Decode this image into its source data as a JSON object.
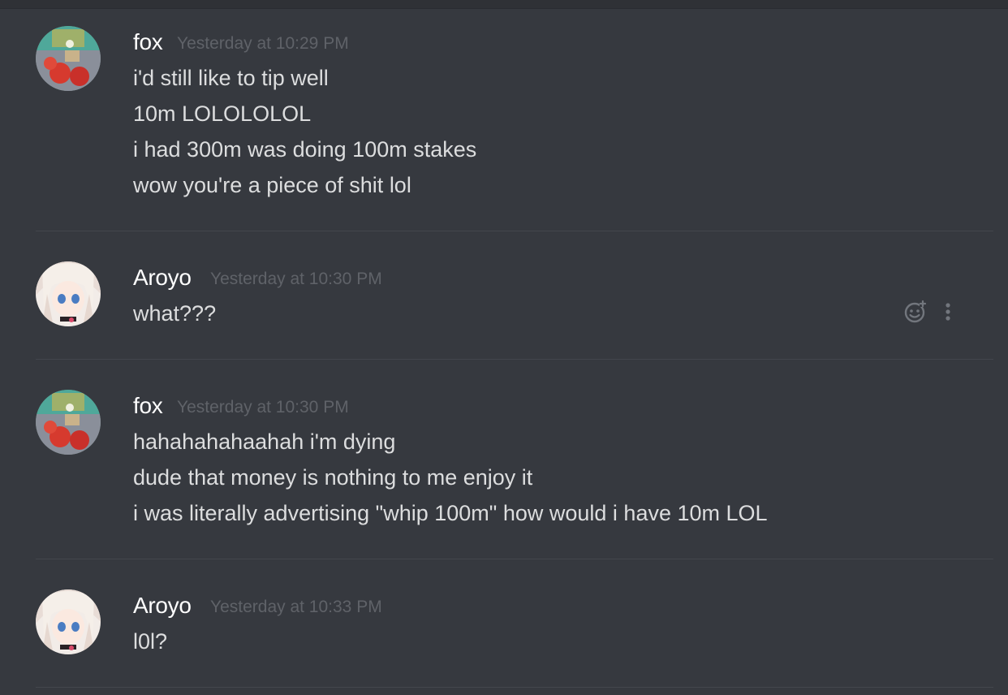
{
  "messages": [
    {
      "author": "fox",
      "timestamp": "Yesterday at 10:29 PM",
      "avatar": "fox-avatar",
      "lines": [
        "i'd still like to tip well",
        "10m LOLOLOLOL",
        "i had 300m was doing 100m stakes",
        "wow you're a piece of shit lol"
      ]
    },
    {
      "author": "Aroyo",
      "timestamp": "Yesterday at 10:30 PM",
      "avatar": "aroyo-avatar",
      "lines": [
        "what???"
      ]
    },
    {
      "author": "fox",
      "timestamp": "Yesterday at 10:30 PM",
      "avatar": "fox-avatar",
      "lines": [
        "hahahahahaahah i'm dying",
        "dude that money is nothing to me enjoy it",
        "i was literally advertising \"whip 100m\" how would i have 10m LOL"
      ]
    },
    {
      "author": "Aroyo",
      "timestamp": "Yesterday at 10:33 PM",
      "avatar": "aroyo-avatar",
      "lines": [
        "l0l?"
      ]
    }
  ],
  "hover_actions": {
    "icons": [
      "add-reaction-icon",
      "more-options-icon"
    ]
  },
  "colors": {
    "background": "#36393f",
    "username": "#ffffff",
    "message_text": "#dcddde",
    "timestamp": "#5f6268",
    "divider": "#43464d"
  }
}
